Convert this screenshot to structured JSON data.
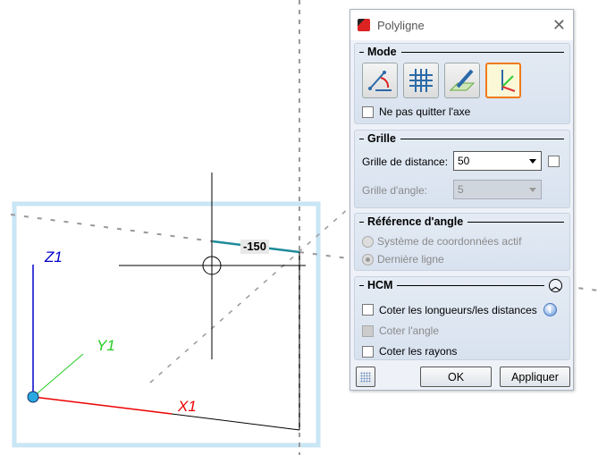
{
  "viewport": {
    "dimension_value": "-150",
    "axis_labels": {
      "x": "X1",
      "y": "Y1",
      "z": "Z1"
    }
  },
  "dialog": {
    "title": "Polyligne",
    "mode": {
      "title": "Mode",
      "buttons": [
        "polyline-angle",
        "grid",
        "sketch-plane",
        "axis-system"
      ],
      "active": 3,
      "checkbox_label": "Ne pas quitter l'axe",
      "checkbox_checked": false
    },
    "grille": {
      "title": "Grille",
      "distance_label": "Grille de distance:",
      "distance_value": "50",
      "distance_checked": false,
      "angle_label": "Grille d'angle:",
      "angle_value": "5"
    },
    "reference": {
      "title": "Référence d'angle",
      "options": [
        "Système de coordonnées actif",
        "Dernière ligne"
      ],
      "selected": 1
    },
    "hcm": {
      "title": "HCM",
      "items": [
        {
          "label": "Coter les longueurs/les distances",
          "checked": false,
          "enabled": true
        },
        {
          "label": "Coter l'angle",
          "checked": false,
          "enabled": false
        },
        {
          "label": "Coter les rayons",
          "checked": false,
          "enabled": true
        }
      ]
    },
    "ok_label": "OK",
    "apply_label": "Appliquer"
  },
  "colors": {
    "active_border": "#f07a1a",
    "selection": "#c9e6f5"
  }
}
